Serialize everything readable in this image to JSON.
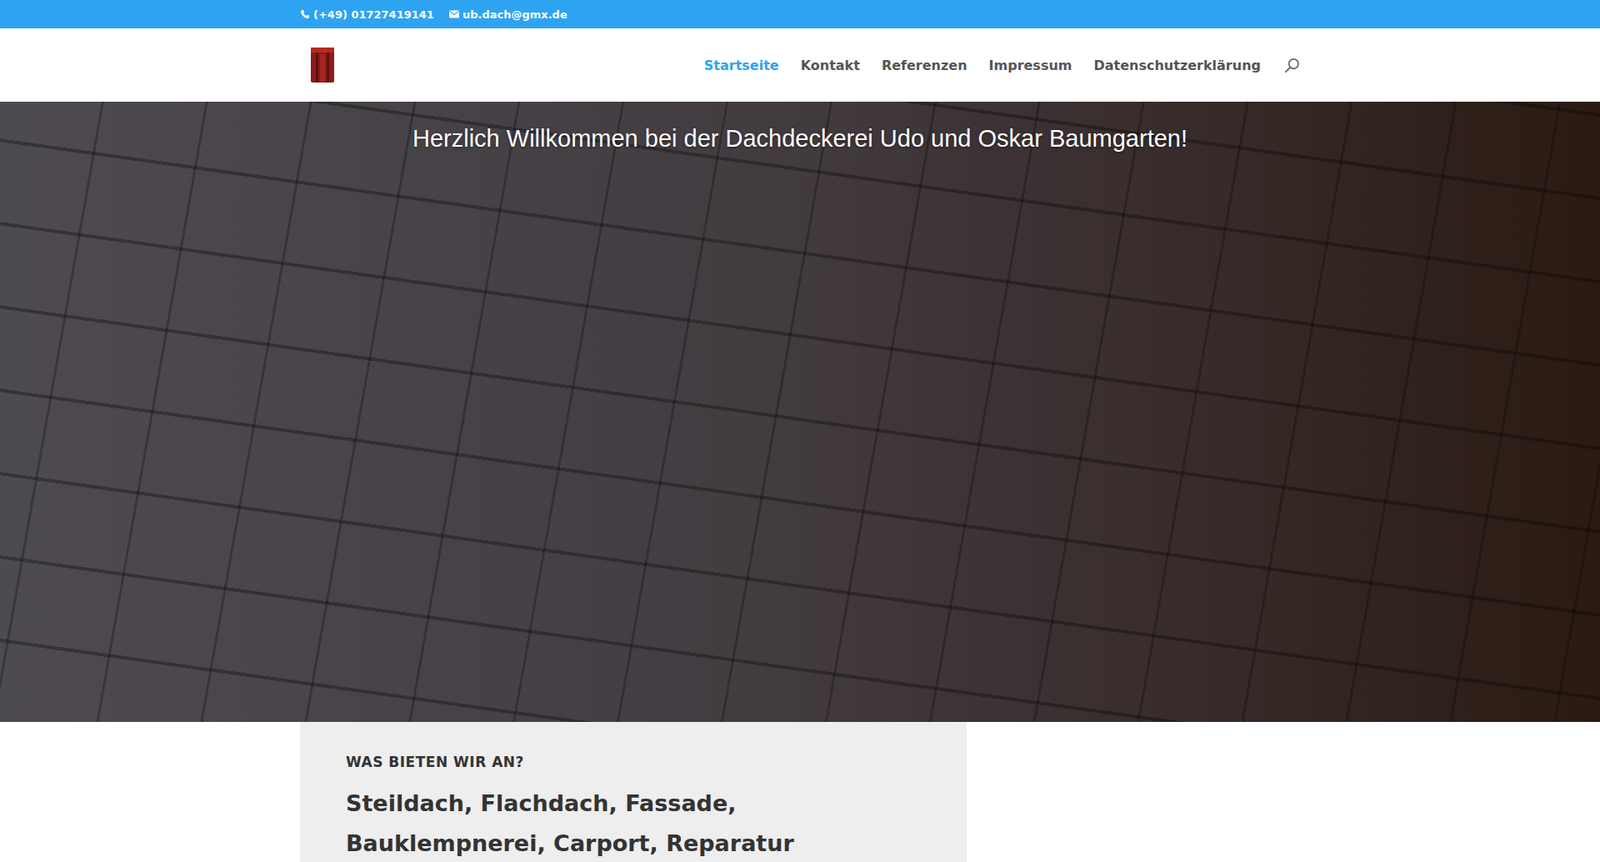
{
  "topbar": {
    "phone": "(+49) 01727419141",
    "email": "ub.dach@gmx.de"
  },
  "header": {
    "nav": [
      {
        "label": "Startseite",
        "selected": true
      },
      {
        "label": "Kontakt",
        "selected": false
      },
      {
        "label": "Referenzen",
        "selected": false
      },
      {
        "label": "Impressum",
        "selected": false
      },
      {
        "label": "Datenschutzerklärung",
        "selected": false
      }
    ]
  },
  "hero": {
    "title": "Herzlich Willkommen bei der Dachdeckerei Udo und Oskar Baumgarten!"
  },
  "services": {
    "label": "WAS BIETEN WIR AN?",
    "heading": "Steildach, Flachdach, Fassade, Bauklempnerei, Carport, Reparatur"
  }
}
